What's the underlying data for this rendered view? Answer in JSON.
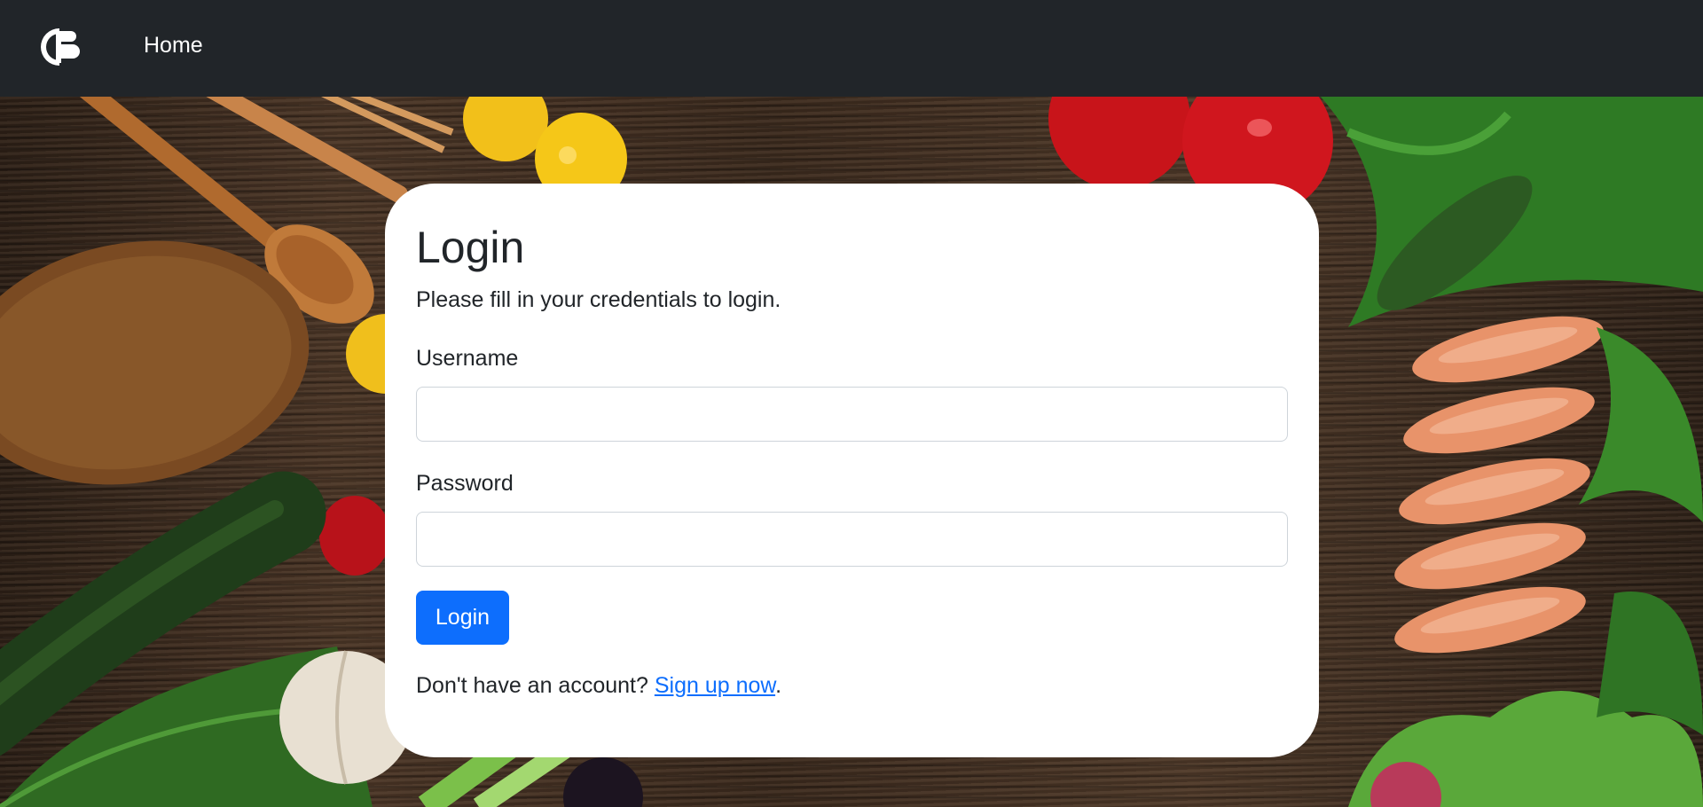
{
  "navbar": {
    "logo_icon": "brand-logo-icon",
    "home_label": "Home"
  },
  "login": {
    "title": "Login",
    "subtitle": "Please fill in your credentials to login.",
    "username_label": "Username",
    "username_value": "",
    "password_label": "Password",
    "password_value": "",
    "submit_label": "Login",
    "signup_prompt": "Don't have an account?",
    "signup_link": "Sign up now",
    "signup_suffix": "."
  },
  "colors": {
    "navbar_bg": "#212529",
    "primary": "#0d6efd",
    "card_bg": "#ffffff",
    "text": "#212529"
  }
}
